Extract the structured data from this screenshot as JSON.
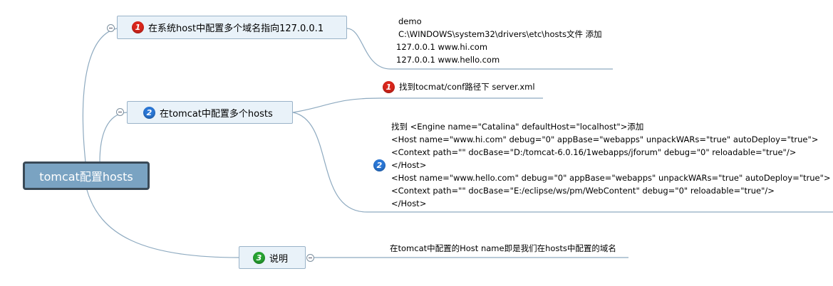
{
  "root": {
    "label": "tomcat配置hosts"
  },
  "branches": [
    {
      "number": "1",
      "label": "在系统host中配置多个域名指向127.0.0.1",
      "note_lines": [
        "demo",
        "C:\\WINDOWS\\system32\\drivers\\etc\\hosts文件 添加",
        "127.0.0.1  www.hi.com",
        "127.0.0.1  www.hello.com"
      ]
    },
    {
      "number": "2",
      "label": "在tomcat中配置多个hosts",
      "children": [
        {
          "number": "1",
          "label": "找到tocmat/conf路径下 server.xml"
        },
        {
          "number": "2",
          "lines": [
            "找到 <Engine name=\"Catalina\" defaultHost=\"localhost\">添加",
            "<Host name=\"www.hi.com\" debug=\"0\" appBase=\"webapps\" unpackWARs=\"true\" autoDeploy=\"true\">",
            "<Context path=\"\" docBase=\"D:/tomcat-6.0.16/1webapps/jforum\" debug=\"0\" reloadable=\"true\"/>",
            "</Host>",
            "<Host name=\"www.hello.com\" debug=\"0\" appBase=\"webapps\" unpackWARs=\"true\" autoDeploy=\"true\">",
            "<Context path=\"\" docBase=\"E:/eclipse/ws/pm/WebContent\" debug=\"0\" reloadable=\"true\"/>",
            "</Host>"
          ]
        }
      ]
    },
    {
      "number": "3",
      "label": "说明",
      "note": "在tomcat中配置的Host name即是我们在hosts中配置的域名"
    }
  ],
  "colors": {
    "topic_fill": "#e9f2f9",
    "topic_border": "#9ab3c8",
    "root_fill": "#7aa3c2",
    "root_border": "#3a4a57",
    "connector": "#8eaac0",
    "badge_red": "#d9261c",
    "badge_blue": "#2a77d6",
    "badge_green": "#27a332"
  },
  "icons": [
    "priority-1-icon",
    "priority-2-icon",
    "priority-3-icon",
    "collapse-icon"
  ]
}
